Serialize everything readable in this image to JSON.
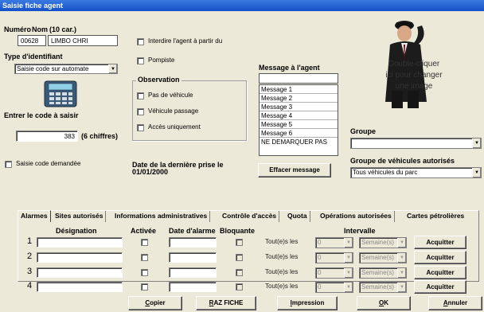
{
  "window": {
    "title": "Saisie fiche agent"
  },
  "agent": {
    "numero_label": "Numéro",
    "nom_label": "Nom",
    "nom_hint": "(10 car.)",
    "numero_value": "00628",
    "nom_value": "LIMBO CHRI"
  },
  "identifiant": {
    "type_label": "Type d'identifiant",
    "type_value": "Saisie code sur automate",
    "code_label": "Entrer le code à saisir",
    "code_value": "383",
    "code_hint": "(6 chiffres)",
    "saisie_demandee_label": "Saisie code demandée"
  },
  "options": {
    "interdire_label": "Interdire l'agent à partir du",
    "pompiste_label": "Pompiste"
  },
  "observation": {
    "title": "Observation",
    "items": [
      "Pas de véhicule",
      "Véhicule passage",
      "Accès uniquement"
    ]
  },
  "derniere_prise": {
    "label": "Date de la dernière prise le",
    "date": "01/01/2000"
  },
  "message": {
    "title": "Message à l'agent",
    "options": [
      "Message 1",
      "Message 2",
      "Message 3",
      "Message 4",
      "Message 5",
      "Message 6",
      "NE DEMARQUER PAS"
    ],
    "effacer_label": "Effacer message"
  },
  "photo": {
    "line1": "Double-cliquer",
    "line2": "ici pour changer",
    "line3": "une image",
    "icon": "person-in-suit-icon"
  },
  "groupe": {
    "label": "Groupe",
    "value": "",
    "vehicules_label": "Groupe de véhicules autorisés",
    "vehicules_value": "Tous véhicules du parc"
  },
  "tabs": [
    "Alarmes",
    "Sites autorisés",
    "Informations administratives",
    "Contrôle d'accès",
    "Quota",
    "Opérations autorisées",
    "Cartes pétrolières"
  ],
  "alarmes": {
    "headers": {
      "designation": "Désignation",
      "activee": "Activée",
      "date_alarme": "Date d'alarme",
      "bloquante": "Bloquante",
      "intervalle": "Intervalle"
    },
    "rows": [
      {
        "num": "1",
        "tous_les": "Tout(e)s les",
        "value": "0",
        "unit": "Semaine(s)",
        "acquitter": "Acquitter"
      },
      {
        "num": "2",
        "tous_les": "Tout(e)s les",
        "value": "0",
        "unit": "Semaine(s)",
        "acquitter": "Acquitter"
      },
      {
        "num": "3",
        "tous_les": "Tout(e)s les",
        "value": "0",
        "unit": "Semaine(s)",
        "acquitter": "Acquitter"
      },
      {
        "num": "4",
        "tous_les": "Tout(e)s les",
        "value": "0",
        "unit": "Semaine(s)",
        "acquitter": "Acquitter"
      }
    ]
  },
  "footer": {
    "copier": "Copier",
    "raz": "RAZ FICHE",
    "impression": "Impression",
    "ok": "OK",
    "annuler": "Annuler"
  }
}
